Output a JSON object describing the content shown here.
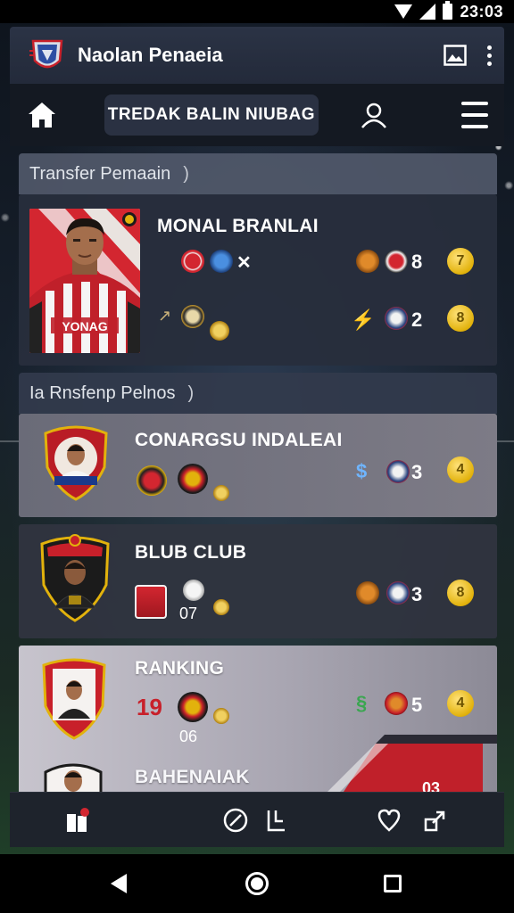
{
  "status_bar": {
    "time": "23:03"
  },
  "app_bar": {
    "title": "Naolan Penaeia"
  },
  "nav": {
    "search_label": "TREDAK BALIN NIUBAG"
  },
  "sections": [
    {
      "title": "Transfer Pemaain",
      "chevron": ")"
    },
    {
      "title": "Ia Rnsfenp Pelnos",
      "chevron": ")"
    }
  ],
  "cards": {
    "featured": {
      "name": "MONAL BRANLAI",
      "jersey_text": "YONAG",
      "stat_top": "8",
      "stat_bottom": "2",
      "coin_top": "7",
      "coin_bottom": "8"
    },
    "card2": {
      "name": "CONARGSU INDALEAI",
      "stat": "3",
      "coin": "4"
    },
    "card3": {
      "name": "BLUB CLUB",
      "sub_num": "07",
      "stat": "3",
      "coin": "8"
    },
    "card4": {
      "name": "RANKING",
      "rank": "19",
      "sub_num": "06",
      "stat": "5",
      "coin": "4",
      "next_name": "BAHENAIAK",
      "banner_num": "03"
    }
  },
  "colors": {
    "accent_red": "#c8202a",
    "coin_gold": "#e2b20c",
    "header_bg": "#2b3345"
  }
}
